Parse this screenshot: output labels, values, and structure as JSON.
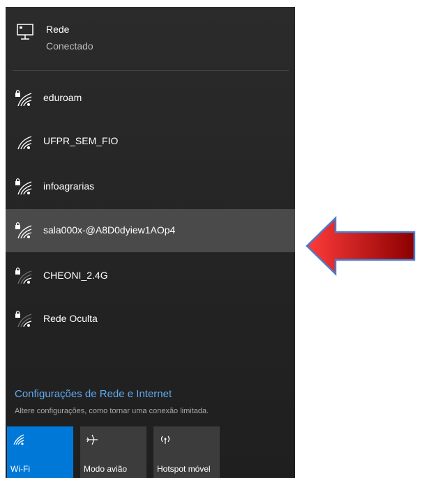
{
  "header": {
    "title": "Rede",
    "status": "Conectado"
  },
  "networks": [
    {
      "name": "eduroam",
      "secured": true,
      "icon": "wifi-locked-icon"
    },
    {
      "name": "UFPR_SEM_FIO",
      "secured": false,
      "icon": "wifi-icon"
    },
    {
      "name": "infoagrarias",
      "secured": true,
      "icon": "wifi-locked-icon"
    },
    {
      "name": "sala000x-@A8D0dyiew1AOp4",
      "secured": true,
      "icon": "wifi-locked-icon",
      "highlighted": true
    },
    {
      "name": "CHEONI_2.4G",
      "secured": true,
      "icon": "wifi-weak-locked-icon"
    },
    {
      "name": "Rede Oculta",
      "secured": true,
      "icon": "wifi-weak-locked-icon"
    }
  ],
  "settings": {
    "link": "Configurações de Rede e Internet",
    "description": "Altere configurações, como tornar uma conexão limitada."
  },
  "quick_actions": [
    {
      "label": "Wi-Fi",
      "icon": "wifi-icon",
      "active": true
    },
    {
      "label": "Modo avião",
      "icon": "airplane-icon",
      "active": false
    },
    {
      "label": "Hotspot móvel",
      "icon": "hotspot-icon",
      "active": false
    }
  ],
  "colors": {
    "accent": "#0078d7",
    "link": "#62aaf0",
    "arrow_start": "#ff3b3b",
    "arrow_end": "#8b0000",
    "arrow_border": "#4a7cc9"
  }
}
